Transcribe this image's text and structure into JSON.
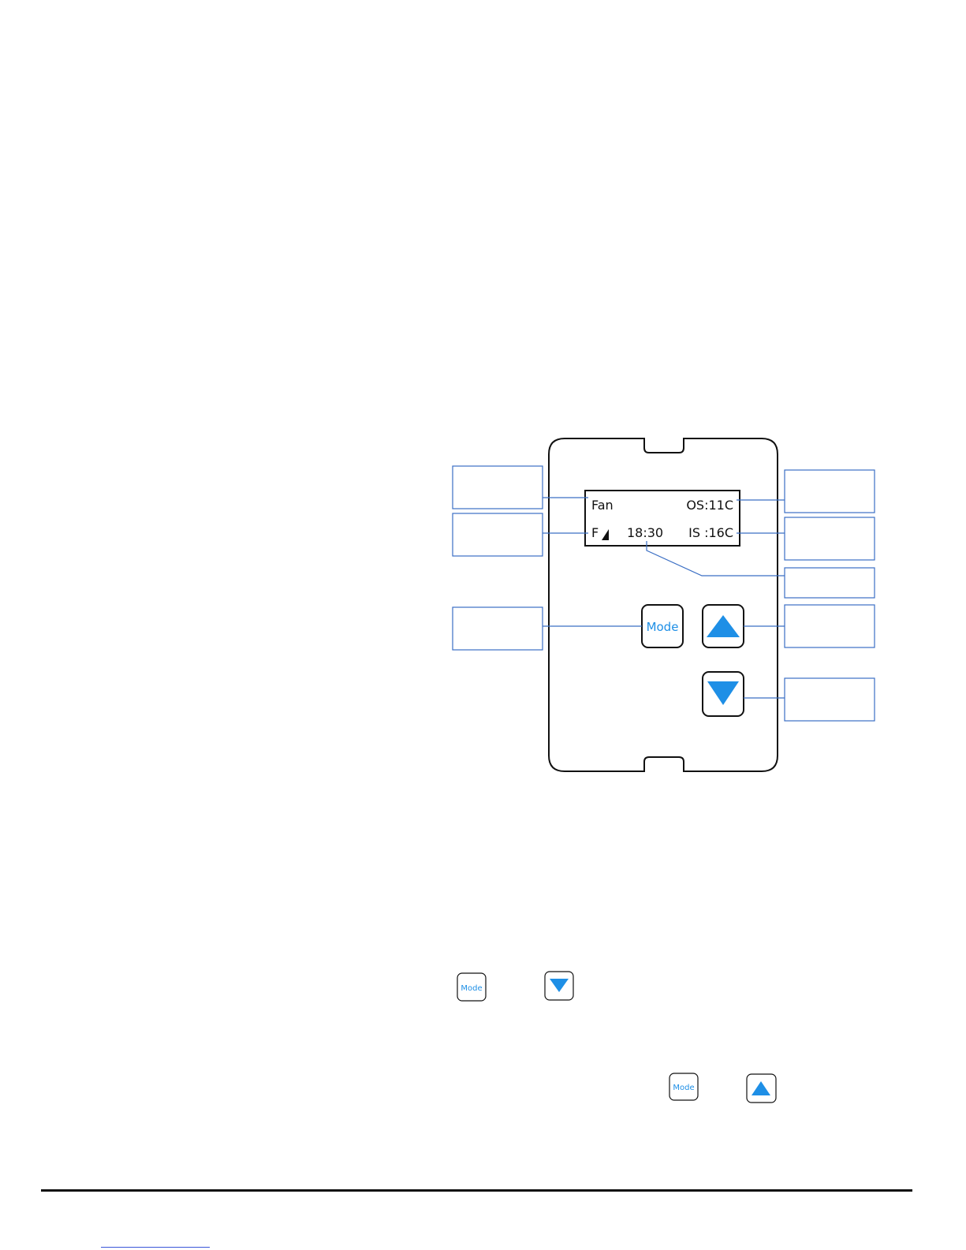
{
  "display": {
    "line1_left": "Fan",
    "line1_right": "OS:11C",
    "line2_left": "F",
    "line2_center": "18:30",
    "line2_right": "IS :16C"
  },
  "buttons": {
    "mode_label": "Mode"
  },
  "inline_buttons": {
    "mode_label_1": "Mode",
    "mode_label_2": "Mode"
  },
  "colors": {
    "accent_blue": "#1e8fe6",
    "callout_border": "#3b6fc4",
    "outline": "#111111"
  }
}
